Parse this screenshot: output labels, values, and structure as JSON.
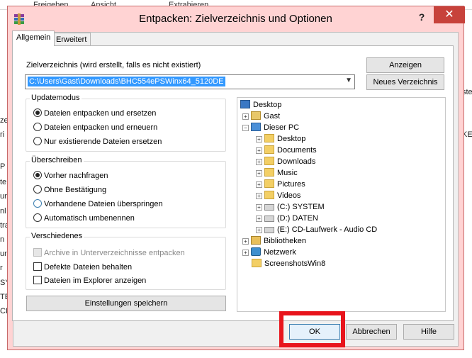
{
  "background": {
    "tabs": [
      "Freigeben",
      "Ansicht",
      "Extrahieren"
    ],
    "left_fragments": [
      "zer",
      "ri",
      "P",
      "te",
      "un",
      "nl",
      "tra",
      "n",
      "ure",
      "r",
      "SY",
      "TE",
      "CD"
    ],
    "right_fragments": [
      "ste",
      "KE"
    ]
  },
  "dialog": {
    "title": "Entpacken: Zielverzeichnis und Optionen",
    "help": "?",
    "close": "✕",
    "tabs": [
      "Allgemein",
      "Erweitert"
    ],
    "path_label": "Zielverzeichnis (wird erstellt, falls es nicht existiert)",
    "path_value": "C:\\Users\\Gast\\Downloads\\BHC554ePSWinx64_5120DE",
    "btn_anzeigen": "Anzeigen",
    "btn_neues": "Neues Verzeichnis",
    "updatemodus": {
      "title": "Updatemodus",
      "options": [
        "Dateien entpacken und ersetzen",
        "Dateien entpacken und erneuern",
        "Nur existierende Dateien ersetzen"
      ]
    },
    "ueberschreiben": {
      "title": "Überschreiben",
      "options": [
        "Vorher nachfragen",
        "Ohne Bestätigung",
        "Vorhandene Dateien überspringen",
        "Automatisch umbenennen"
      ]
    },
    "verschiedenes": {
      "title": "Verschiedenes",
      "options": [
        "Archive in Unterverzeichnisse entpacken",
        "Defekte Dateien behalten",
        "Dateien im Explorer anzeigen"
      ]
    },
    "btn_save": "Einstellungen speichern",
    "tree": {
      "desktop": "Desktop",
      "gast": "Gast",
      "dieser_pc": "Dieser PC",
      "children": [
        "Desktop",
        "Documents",
        "Downloads",
        "Music",
        "Pictures",
        "Videos",
        "(C:) SYSTEM",
        "(D:) DATEN",
        "(E:) CD-Laufwerk - Audio CD"
      ],
      "bibliotheken": "Bibliotheken",
      "netzwerk": "Netzwerk",
      "screenshots": "ScreenshotsWin8"
    },
    "btn_ok": "OK",
    "btn_abbrechen": "Abbrechen",
    "btn_hilfe": "Hilfe"
  },
  "colors": {
    "highlight": "#e8141c",
    "close_button": "#c7423b",
    "selection": "#3399ff"
  }
}
